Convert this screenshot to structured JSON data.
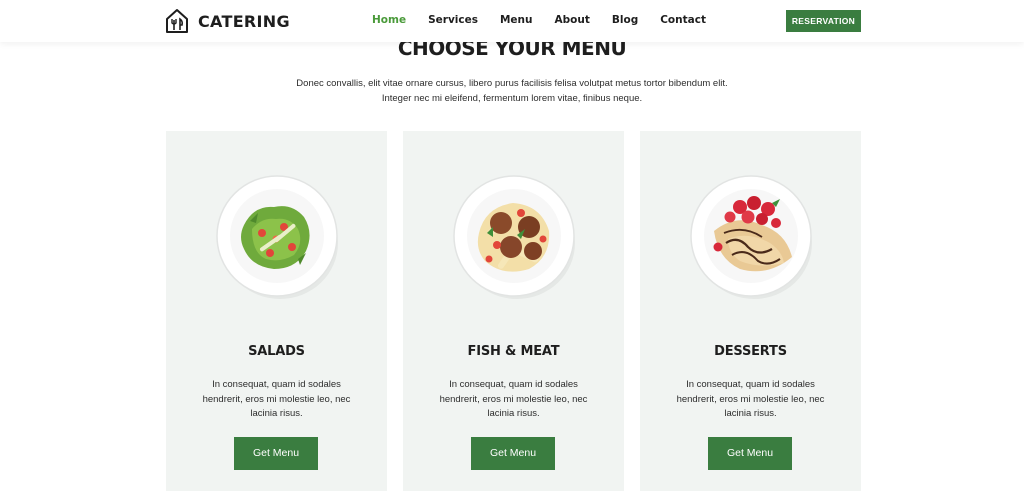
{
  "header": {
    "brand": "CATERING",
    "nav": [
      "Home",
      "Services",
      "Menu",
      "About",
      "Blog",
      "Contact"
    ],
    "active_nav": "Home",
    "cta_label": "RESERVATION"
  },
  "section": {
    "title": "CHOOSE YOUR MENU",
    "description_line1": "Donec convallis, elit vitae ornare cursus, libero purus facilisis felisa volutpat metus tortor bibendum elit.",
    "description_line2": "Integer nec mi eleifend, fermentum lorem vitae, finibus neque."
  },
  "cards": [
    {
      "title": "SALADS",
      "image": "salad-plate",
      "description": "In consequat, quam id sodales hendrerit, eros mi molestie leo, nec lacinia risus.",
      "button": "Get Menu"
    },
    {
      "title": "FISH & MEAT",
      "image": "pasta-meatballs-plate",
      "description": "In consequat, quam id sodales hendrerit, eros mi molestie leo, nec lacinia risus.",
      "button": "Get Menu"
    },
    {
      "title": "DESSERTS",
      "image": "crepes-strawberries-plate",
      "description": "In consequat, quam id sodales hendrerit, eros mi molestie leo, nec lacinia risus.",
      "button": "Get Menu"
    }
  ],
  "colors": {
    "accent": "#3a7d40",
    "active_nav": "#4a9a3a",
    "card_bg": "#f1f4f2",
    "text": "#1e1e1e"
  }
}
